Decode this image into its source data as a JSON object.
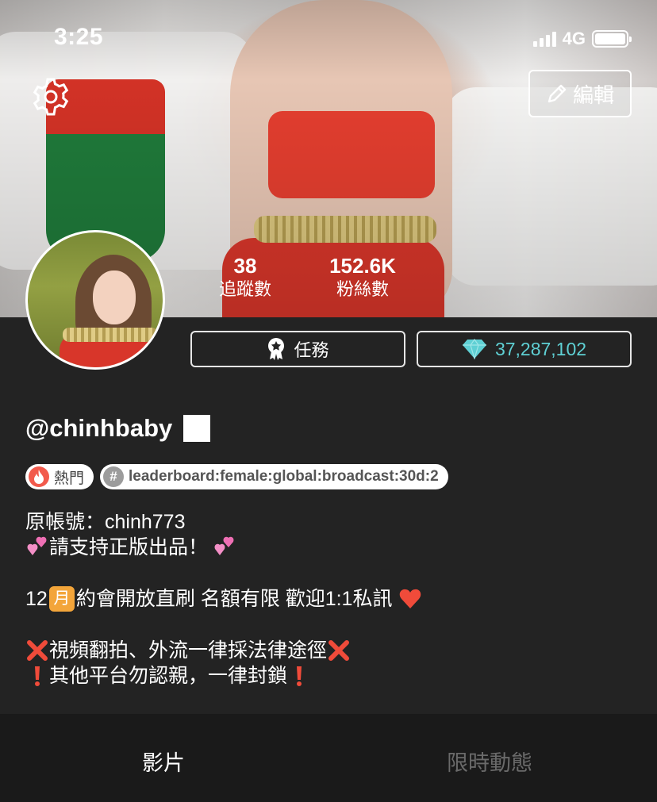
{
  "status_bar": {
    "time": "3:25",
    "network": "4G"
  },
  "header": {
    "edit_label": "編輯"
  },
  "stats": [
    {
      "value": "38",
      "label": "追蹤數"
    },
    {
      "value": "152.6K",
      "label": "粉絲數"
    }
  ],
  "actions": {
    "task_label": "任務",
    "diamond_count": "37,287,102"
  },
  "profile": {
    "handle": "@chinhbaby",
    "tags": [
      {
        "label": "熱門",
        "icon": "flame-icon"
      },
      {
        "label": "leaderboard:female:global:broadcast:30d:2",
        "icon": "hash-icon"
      }
    ],
    "bio": {
      "line1": "原帳號：chinh773",
      "line2": "請支持正版出品！",
      "line3_prefix": "12",
      "line3_month_badge": "月",
      "line3_text": "約會開放直刷 名額有限 歡迎1:1私訊",
      "line4": "視頻翻拍、外流一律採法律途徑",
      "line5": "其他平台勿認親，一律封鎖"
    }
  },
  "tabs": [
    {
      "label": "影片",
      "active": true
    },
    {
      "label": "限時動態",
      "active": false
    }
  ],
  "colors": {
    "background": "#232323",
    "diamond_text": "#5fd0d4",
    "tab_inactive": "#6a6a6a",
    "month_badge": "#f3a53a"
  }
}
